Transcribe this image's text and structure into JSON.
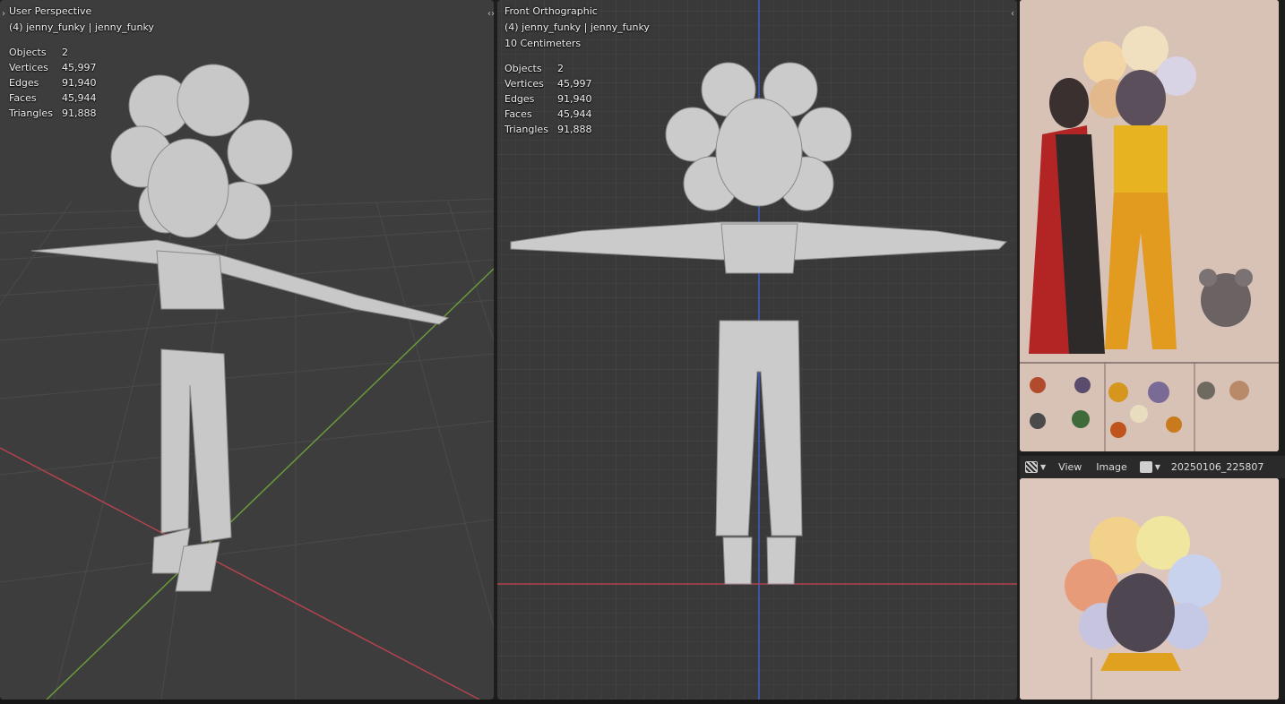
{
  "viewport_left": {
    "view_name": "User Perspective",
    "object_path": "(4) jenny_funky | jenny_funky",
    "stats": [
      {
        "label": "Objects",
        "value": "2"
      },
      {
        "label": "Vertices",
        "value": "45,997"
      },
      {
        "label": "Edges",
        "value": "91,940"
      },
      {
        "label": "Faces",
        "value": "45,944"
      },
      {
        "label": "Triangles",
        "value": "91,888"
      }
    ]
  },
  "viewport_right": {
    "view_name": "Front Orthographic",
    "object_path": "(4) jenny_funky | jenny_funky",
    "grid_scale": "10 Centimeters",
    "stats": [
      {
        "label": "Objects",
        "value": "2"
      },
      {
        "label": "Vertices",
        "value": "45,997"
      },
      {
        "label": "Edges",
        "value": "91,940"
      },
      {
        "label": "Faces",
        "value": "45,944"
      },
      {
        "label": "Triangles",
        "value": "91,888"
      }
    ]
  },
  "image_editor": {
    "menu_view": "View",
    "menu_image": "Image",
    "image_name": "20250106_225807",
    "editor_icon": "image-editor-icon",
    "image_icon": "image-browse-icon"
  },
  "colors": {
    "x_axis": "#b2434e",
    "y_axis": "#6a9a3c",
    "z_axis": "#3f5ecc",
    "viewport_bg": "#3d3d3d"
  }
}
